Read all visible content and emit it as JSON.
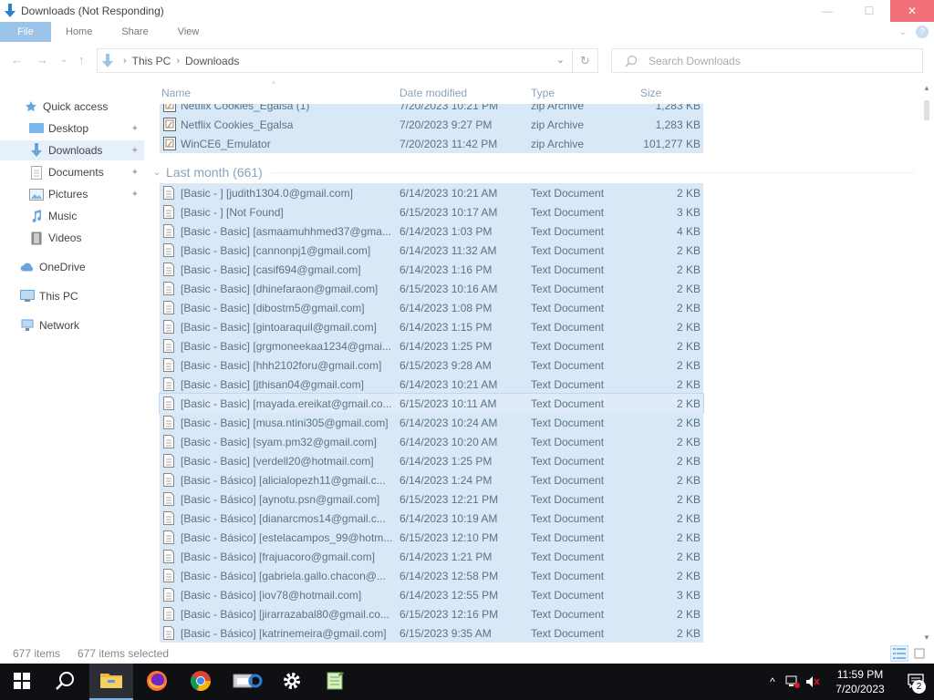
{
  "window": {
    "title": "Downloads (Not Responding)",
    "controls": {
      "minimize": "—",
      "maximize": "☐",
      "close": "✕"
    }
  },
  "ribbon": {
    "tabs": [
      {
        "label": "File"
      },
      {
        "label": "Home"
      },
      {
        "label": "Share"
      },
      {
        "label": "View"
      }
    ],
    "expand": "⌄"
  },
  "navbar": {
    "back": "←",
    "forward": "→",
    "recent": "⌄",
    "up": "↑",
    "breadcrumb": [
      "This PC",
      "Downloads"
    ],
    "separator": "›",
    "dropdown": "⌄",
    "refresh": "↻",
    "search_placeholder": "Search Downloads"
  },
  "sidebar": {
    "items": [
      {
        "label": "Quick access",
        "icon": "star-icon"
      },
      {
        "label": "Desktop",
        "icon": "desktop-icon",
        "pinned": true
      },
      {
        "label": "Downloads",
        "icon": "download-icon",
        "pinned": true,
        "selected": true
      },
      {
        "label": "Documents",
        "icon": "document-icon",
        "pinned": true
      },
      {
        "label": "Pictures",
        "icon": "picture-icon",
        "pinned": true
      },
      {
        "label": "Music",
        "icon": "music-icon"
      },
      {
        "label": "Videos",
        "icon": "video-icon"
      },
      {
        "label": "OneDrive",
        "icon": "cloud-icon"
      },
      {
        "label": "This PC",
        "icon": "computer-icon"
      },
      {
        "label": "Network",
        "icon": "network-icon"
      }
    ],
    "pin_glyph": "📌"
  },
  "columns": {
    "name": "Name",
    "date": "Date modified",
    "type": "Type",
    "size": "Size"
  },
  "top_files": [
    {
      "name": "Netflix Cookies_Egalsa (1)",
      "date": "7/20/2023 10:21 PM",
      "type": "zip Archive",
      "size": "1,283 KB"
    },
    {
      "name": "Netflix Cookies_Egalsa",
      "date": "7/20/2023 9:27 PM",
      "type": "zip Archive",
      "size": "1,283 KB"
    },
    {
      "name": "WinCE6_Emulator",
      "date": "7/20/2023 11:42 PM",
      "type": "zip Archive",
      "size": "101,277 KB"
    }
  ],
  "group": {
    "label": "Last month (661)",
    "chevron": "⌄"
  },
  "files": [
    {
      "name": "[Basic - ] [judith1304.0@gmail.com]",
      "date": "6/14/2023 10:21 AM",
      "type": "Text Document",
      "size": "2 KB"
    },
    {
      "name": "[Basic - ] [Not Found]",
      "date": "6/15/2023 10:17 AM",
      "type": "Text Document",
      "size": "3 KB"
    },
    {
      "name": "[Basic - Basic] [asmaamuhhmed37@gma...",
      "date": "6/14/2023 1:03 PM",
      "type": "Text Document",
      "size": "4 KB"
    },
    {
      "name": "[Basic - Basic] [cannonpj1@gmail.com]",
      "date": "6/14/2023 11:32 AM",
      "type": "Text Document",
      "size": "2 KB"
    },
    {
      "name": "[Basic - Basic] [casif694@gmail.com]",
      "date": "6/14/2023 1:16 PM",
      "type": "Text Document",
      "size": "2 KB"
    },
    {
      "name": "[Basic - Basic] [dhinefaraon@gmail.com]",
      "date": "6/15/2023 10:16 AM",
      "type": "Text Document",
      "size": "2 KB"
    },
    {
      "name": "[Basic - Basic] [dibostm5@gmail.com]",
      "date": "6/14/2023 1:08 PM",
      "type": "Text Document",
      "size": "2 KB"
    },
    {
      "name": "[Basic - Basic] [gintoaraquil@gmail.com]",
      "date": "6/14/2023 1:15 PM",
      "type": "Text Document",
      "size": "2 KB"
    },
    {
      "name": "[Basic - Basic] [grgmoneekaa1234@gmai...",
      "date": "6/14/2023 1:25 PM",
      "type": "Text Document",
      "size": "2 KB"
    },
    {
      "name": "[Basic - Basic] [hhh2102foru@gmail.com]",
      "date": "6/15/2023 9:28 AM",
      "type": "Text Document",
      "size": "2 KB"
    },
    {
      "name": "[Basic - Basic] [jthisan04@gmail.com]",
      "date": "6/14/2023 10:21 AM",
      "type": "Text Document",
      "size": "2 KB"
    },
    {
      "name": "[Basic - Basic] [mayada.ereikat@gmail.co...",
      "date": "6/15/2023 10:11 AM",
      "type": "Text Document",
      "size": "2 KB",
      "focused": true
    },
    {
      "name": "[Basic - Basic] [musa.ntini305@gmail.com]",
      "date": "6/14/2023 10:24 AM",
      "type": "Text Document",
      "size": "2 KB"
    },
    {
      "name": "[Basic - Basic] [syam.pm32@gmail.com]",
      "date": "6/14/2023 10:20 AM",
      "type": "Text Document",
      "size": "2 KB"
    },
    {
      "name": "[Basic - Basic] [verdell20@hotmail.com]",
      "date": "6/14/2023 1:25 PM",
      "type": "Text Document",
      "size": "2 KB"
    },
    {
      "name": "[Basic - Básico] [alicialopezh11@gmail.c...",
      "date": "6/14/2023 1:24 PM",
      "type": "Text Document",
      "size": "2 KB"
    },
    {
      "name": "[Basic - Básico] [aynotu.psn@gmail.com]",
      "date": "6/15/2023 12:21 PM",
      "type": "Text Document",
      "size": "2 KB"
    },
    {
      "name": "[Basic - Básico] [dianarcmos14@gmail.c...",
      "date": "6/14/2023 10:19 AM",
      "type": "Text Document",
      "size": "2 KB"
    },
    {
      "name": "[Basic - Básico] [estelacampos_99@hotm...",
      "date": "6/15/2023 12:10 PM",
      "type": "Text Document",
      "size": "2 KB"
    },
    {
      "name": "[Basic - Básico] [frajuacoro@gmail.com]",
      "date": "6/14/2023 1:21 PM",
      "type": "Text Document",
      "size": "2 KB"
    },
    {
      "name": "[Basic - Básico] [gabriela.gallo.chacon@...",
      "date": "6/14/2023 12:58 PM",
      "type": "Text Document",
      "size": "2 KB"
    },
    {
      "name": "[Basic - Básico] [iov78@hotmail.com]",
      "date": "6/14/2023 12:55 PM",
      "type": "Text Document",
      "size": "3 KB"
    },
    {
      "name": "[Basic - Básico] [jirarrazabal80@gmail.co...",
      "date": "6/15/2023 12:16 PM",
      "type": "Text Document",
      "size": "2 KB"
    },
    {
      "name": "[Basic - Básico] [katrinemeira@gmail.com]",
      "date": "6/15/2023 9:35 AM",
      "type": "Text Document",
      "size": "2 KB"
    }
  ],
  "status": {
    "item_count": "677 items",
    "selected": "677 items selected"
  },
  "taskbar": {
    "apps": [
      {
        "name": "start-button",
        "icon": "windows-logo-icon"
      },
      {
        "name": "search-button",
        "icon": "search-icon"
      },
      {
        "name": "file-explorer-button",
        "icon": "folder-icon",
        "active": true
      },
      {
        "name": "firefox-button",
        "icon": "firefox-icon"
      },
      {
        "name": "chrome-button",
        "icon": "chrome-icon"
      },
      {
        "name": "app-button",
        "icon": "app-icon"
      },
      {
        "name": "settings-button",
        "icon": "gear-icon"
      },
      {
        "name": "notepad-button",
        "icon": "notepad-icon"
      }
    ],
    "time": "11:59 PM",
    "date": "7/20/2023",
    "notifications": "2",
    "tray_chevron": "^"
  },
  "colors": {
    "selection": "#d9e8f7",
    "file_tab": "#9cc3e8",
    "close_button": "#f1707a",
    "taskbar": "#0e1013",
    "accent": "#7fb3e6"
  }
}
